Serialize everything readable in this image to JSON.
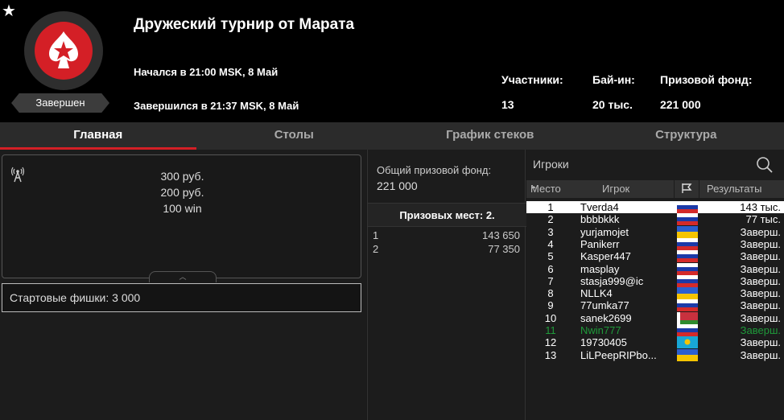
{
  "header": {
    "title": "Дружеский турнир от Марата",
    "started": "Начался в 21:00 MSK, 8 Май",
    "ended": "Завершился в 21:37 MSK, 8 Май",
    "status": "Завершен",
    "stats": [
      {
        "label": "Участники:",
        "value": "13"
      },
      {
        "label": "Бай-ин:",
        "value": "20 тыс."
      },
      {
        "label": "Призовой фонд:",
        "value": "221 000"
      }
    ]
  },
  "tabs": [
    {
      "label": "Главная",
      "active": true
    },
    {
      "label": "Столы",
      "active": false
    },
    {
      "label": "График стеков",
      "active": false
    },
    {
      "label": "Структура",
      "active": false
    }
  ],
  "prizes": {
    "lines": [
      "300 руб.",
      "200 руб.",
      "100 win"
    ],
    "starting_chips_label": "Стартовые фишки:",
    "starting_chips_value": "3 000"
  },
  "prize_pool": {
    "label": "Общий призовой фонд:",
    "value": "221 000",
    "places_label": "Призовых мест: 2.",
    "places": [
      {
        "place": "1",
        "amount": "143 650"
      },
      {
        "place": "2",
        "amount": "77 350"
      }
    ]
  },
  "players": {
    "title": "Игроки",
    "columns": {
      "place": "Место",
      "player": "Игрок",
      "results": "Результаты"
    },
    "selected_index": 0,
    "highlight_index": 10,
    "rows": [
      {
        "place": "1",
        "name": "Tverda4",
        "flag": "ru",
        "result": "143 тыс."
      },
      {
        "place": "2",
        "name": "bbbbkkk",
        "flag": "ru",
        "result": "77 тыс."
      },
      {
        "place": "3",
        "name": "yurjamojet",
        "flag": "ua",
        "result": "Заверш."
      },
      {
        "place": "4",
        "name": "Panikerr",
        "flag": "ru",
        "result": "Заверш."
      },
      {
        "place": "5",
        "name": "Kasper447",
        "flag": "ru",
        "result": "Заверш."
      },
      {
        "place": "6",
        "name": "masplay",
        "flag": "ru",
        "result": "Заверш."
      },
      {
        "place": "7",
        "name": "stasja999@ic",
        "flag": "ru",
        "result": "Заверш."
      },
      {
        "place": "8",
        "name": "NLLK4",
        "flag": "ua",
        "result": "Заверш."
      },
      {
        "place": "9",
        "name": "77umka77",
        "flag": "ru",
        "result": "Заверш."
      },
      {
        "place": "10",
        "name": "sanek2699",
        "flag": "by",
        "result": "Заверш."
      },
      {
        "place": "11",
        "name": "Nwin777",
        "flag": "ru",
        "result": "Заверш."
      },
      {
        "place": "12",
        "name": "19730405",
        "flag": "kz",
        "result": "Заверш."
      },
      {
        "place": "13",
        "name": "LiLPeepRIPbo...",
        "flag": "ua",
        "result": "Заверш."
      }
    ]
  }
}
